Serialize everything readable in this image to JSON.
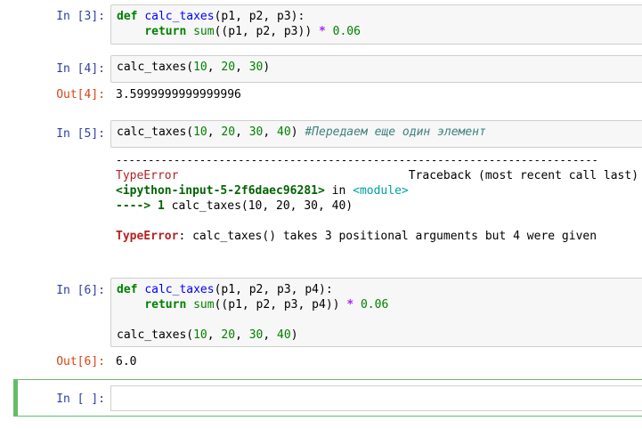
{
  "cells": {
    "c3": {
      "prompt": "In [3]:",
      "line1": {
        "kw": "def",
        "fn": "calc_taxes",
        "args": "(p1, p2, p3):"
      },
      "line2": {
        "indent": "    ",
        "kw": "return",
        "bi": "sum",
        "args": "((p1, p2, p3)) ",
        "op": "*",
        "num": "0.06"
      }
    },
    "c4": {
      "prompt": "In [4]:",
      "call": {
        "name": "calc_taxes(",
        "n1": "10",
        "sep1": ", ",
        "n2": "20",
        "sep2": ", ",
        "n3": "30",
        "end": ")"
      },
      "out_prompt": "Out[4]:",
      "output": "3.5999999999999996"
    },
    "c5": {
      "prompt": "In [5]:",
      "call": {
        "name": "calc_taxes(",
        "n1": "10",
        "sep1": ", ",
        "n2": "20",
        "sep2": ", ",
        "n3": "30",
        "sep3": ", ",
        "n4": "40",
        "end": ") ",
        "comment": "#Передаем еще один элемент"
      },
      "tb": {
        "dashes": "---------------------------------------------------------------------------",
        "err_name": "TypeError",
        "spacer": "                                 ",
        "tb_label": "Traceback (most recent call last)",
        "input_ref": "<ipython-input-5-2f6daec96281>",
        "in_word": " in ",
        "module": "<module>",
        "arrow": "----> 1 ",
        "arrow_code": "calc_taxes(10, 20, 30, 40)",
        "final_err": "TypeError",
        "final_msg": ": calc_taxes() takes 3 positional arguments but 4 were given"
      }
    },
    "c6": {
      "prompt": "In [6]:",
      "line1": {
        "kw": "def",
        "fn": "calc_taxes",
        "args": "(p1, p2, p3, p4):"
      },
      "line2": {
        "indent": "    ",
        "kw": "return",
        "bi": "sum",
        "args": "((p1, p2, p3, p4)) ",
        "op": "*",
        "num": "0.06"
      },
      "line4": {
        "name": "calc_taxes(",
        "n1": "10",
        "sep1": ", ",
        "n2": "20",
        "sep2": ", ",
        "n3": "30",
        "sep3": ", ",
        "n4": "40",
        "end": ")"
      },
      "out_prompt": "Out[6]:",
      "output": "6.0"
    },
    "c7": {
      "prompt": "In [ ]:"
    }
  }
}
